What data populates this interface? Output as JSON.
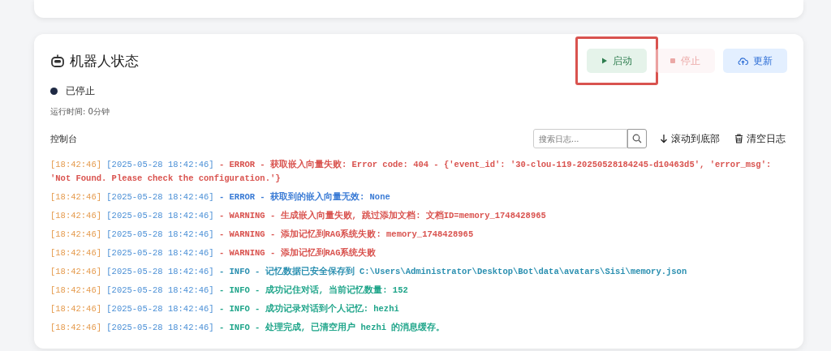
{
  "panel": {
    "title": "机器人状态",
    "buttons": [
      {
        "kind": "start",
        "label": "启动",
        "disabled": false,
        "highlighted": true
      },
      {
        "kind": "stop",
        "label": "停止",
        "disabled": true,
        "highlighted": false
      },
      {
        "kind": "update",
        "label": "更新",
        "disabled": false,
        "highlighted": false
      }
    ],
    "status": {
      "label": "已停止",
      "running": false
    },
    "uptime": "运行时间: 0分钟"
  },
  "console": {
    "title": "控制台",
    "search": {
      "placeholder": "搜索日志..."
    },
    "scroll_button": "滚动到底部",
    "clear_button": "清空日志",
    "lines": [
      {
        "time": "[18:42:46]",
        "stamp": "[2025-05-28 18:42:46]",
        "message": " - ERROR - 获取嵌入向量失败: Error code: 404 - {'event_id': '30-clou-119-20250528184245-d10463d5', 'error_msg': 'Not Found. Please check the configuration.'}",
        "color": "#d9534f"
      },
      {
        "time": "[18:42:46]",
        "stamp": "[2025-05-28 18:42:46]",
        "message": " - ERROR - 获取到的嵌入向量无效: None",
        "color": "#3a7bd5"
      },
      {
        "time": "[18:42:46]",
        "stamp": "[2025-05-28 18:42:46]",
        "message": " - WARNING - 生成嵌入向量失败, 跳过添加文档: 文档ID=memory_1748428965",
        "color": "#d9534f"
      },
      {
        "time": "[18:42:46]",
        "stamp": "[2025-05-28 18:42:46]",
        "message": " - WARNING - 添加记忆到RAG系统失败: memory_1748428965",
        "color": "#d9534f"
      },
      {
        "time": "[18:42:46]",
        "stamp": "[2025-05-28 18:42:46]",
        "message": " - WARNING - 添加记忆到RAG系统失败",
        "color": "#d9534f"
      },
      {
        "time": "[18:42:46]",
        "stamp": "[2025-05-28 18:42:46]",
        "message": " - INFO - 记忆数据已安全保存到 C:\\Users\\Administrator\\Desktop\\Bot\\data\\avatars\\Sisi\\memory.json",
        "color": "#2a8fb0"
      },
      {
        "time": "[18:42:46]",
        "stamp": "[2025-05-28 18:42:46]",
        "message": " - INFO - 成功记住对话, 当前记忆数量: 152",
        "color": "#1fa58a"
      },
      {
        "time": "[18:42:46]",
        "stamp": "[2025-05-28 18:42:46]",
        "message": " - INFO - 成功记录对话到个人记忆: hezhi",
        "color": "#1fa58a"
      },
      {
        "time": "[18:42:46]",
        "stamp": "[2025-05-28 18:42:46]",
        "message": " - INFO - 处理完成, 已清空用户 hezhi 的消息缓存。",
        "color": "#1fa58a"
      }
    ]
  }
}
